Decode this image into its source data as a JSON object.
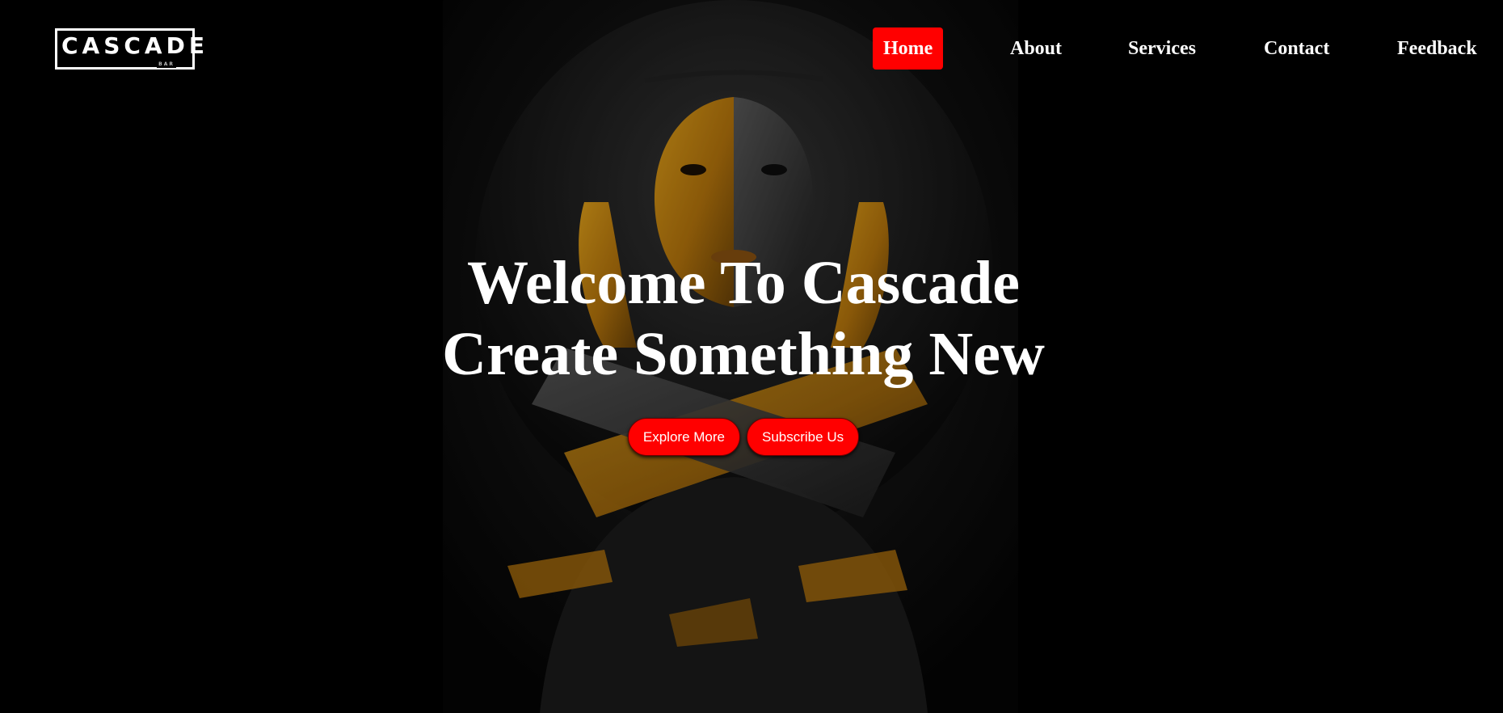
{
  "brand": {
    "logo_text": "CASCADE",
    "logo_subtext": "BAR"
  },
  "nav": {
    "items": [
      {
        "label": "Home",
        "active": true
      },
      {
        "label": "About",
        "active": false
      },
      {
        "label": "Services",
        "active": false
      },
      {
        "label": "Contact",
        "active": false
      },
      {
        "label": "Feedback",
        "active": false
      }
    ]
  },
  "hero": {
    "line1": "Welcome To Cascade",
    "line2": "Create Something New",
    "buttons": {
      "explore": "Explore More",
      "subscribe": "Subscribe Us"
    }
  },
  "colors": {
    "background": "#000000",
    "accent": "#ff0000",
    "text": "#ffffff",
    "gold": "#c8860f"
  }
}
